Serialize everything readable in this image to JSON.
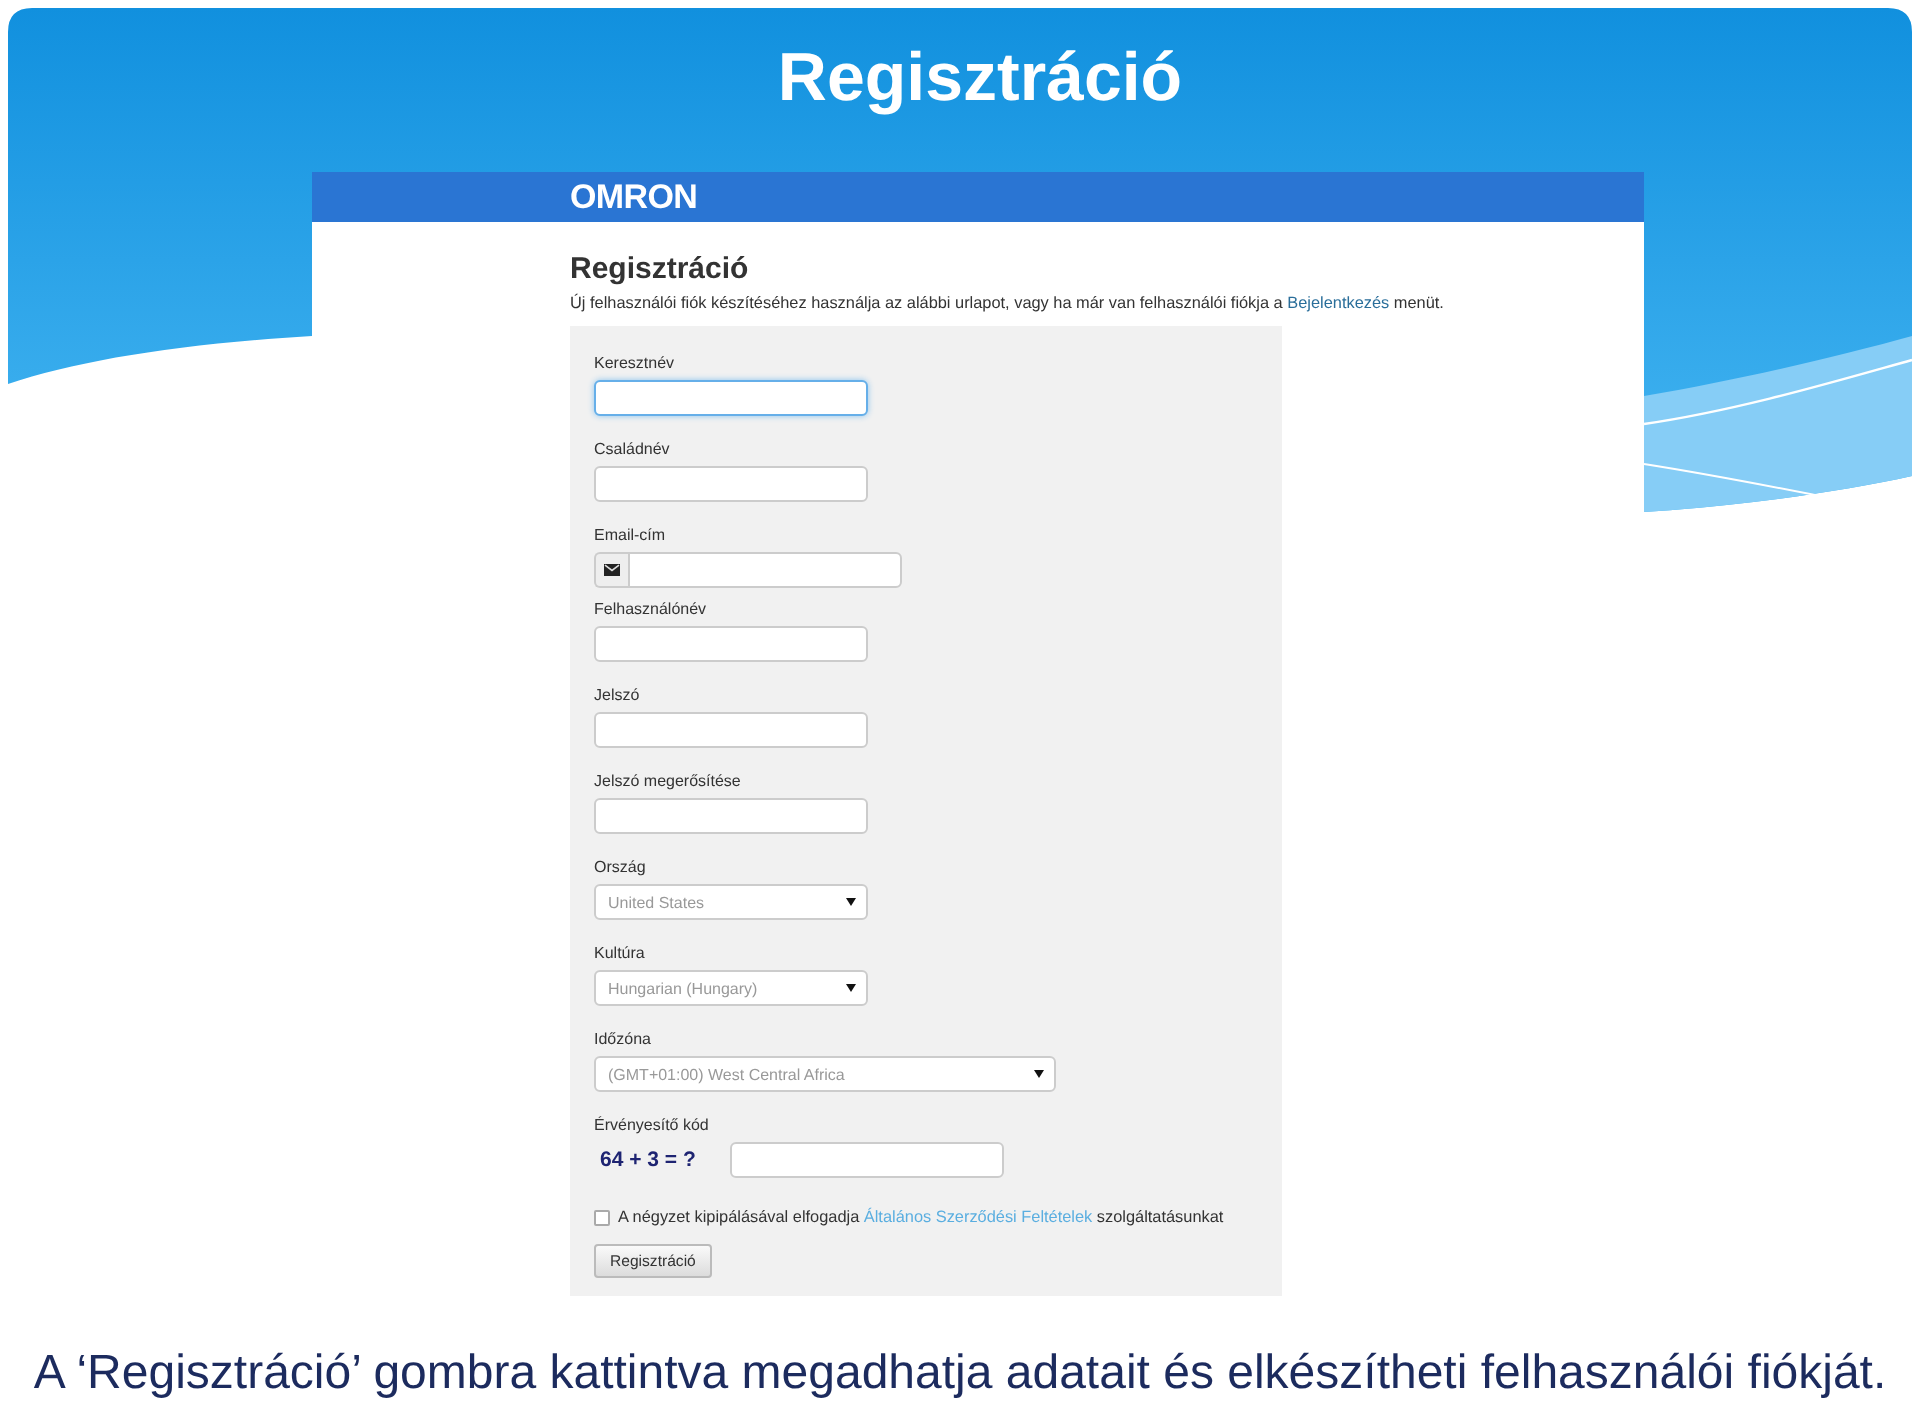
{
  "slide": {
    "title": "Regisztráció",
    "caption": "A ‘Regisztráció’ gombra kattintva megadhatja adatait és elkészítheti felhasználói fiókját."
  },
  "screenshot": {
    "logo": "OMRON",
    "heading": "Regisztráció",
    "intro": {
      "text_before": "Új felhasználói fiók készítéséhez használja az alábbi urlapot, vagy ha már van felhasználói fiókja a ",
      "link": "Bejelentkezés",
      "text_after": " menüt."
    },
    "fields": [
      {
        "kind": "text",
        "label": "Keresztnév",
        "focused": true,
        "wide": false
      },
      {
        "kind": "text",
        "label": "Családnév",
        "focused": false,
        "wide": false
      },
      {
        "kind": "email",
        "label": "Email-cím",
        "focused": false,
        "wide": false
      },
      {
        "kind": "text",
        "label": "Felhasználónév",
        "focused": false,
        "wide": false
      },
      {
        "kind": "password",
        "label": "Jelszó",
        "focused": false,
        "wide": false
      },
      {
        "kind": "password",
        "label": "Jelszó megerősítése",
        "focused": false,
        "wide": false
      },
      {
        "kind": "select",
        "label": "Ország",
        "value": "United States",
        "focused": false,
        "wide": false
      },
      {
        "kind": "select",
        "label": "Kultúra",
        "value": "Hungarian (Hungary)",
        "focused": false,
        "wide": false
      },
      {
        "kind": "select",
        "label": "Időzóna",
        "value": "(GMT+01:00) West Central Africa",
        "focused": false,
        "wide": true
      }
    ],
    "captcha": {
      "label": "Érvényesítő kód",
      "question": "64 + 3 = ?"
    },
    "terms": {
      "checked": false,
      "text_before": "A négyzet kipipálásával elfogadja ",
      "link": "Általános Szerződési Feltételek",
      "text_after": " szolgáltatásunkat"
    },
    "submit_button": "Regisztráció"
  }
}
